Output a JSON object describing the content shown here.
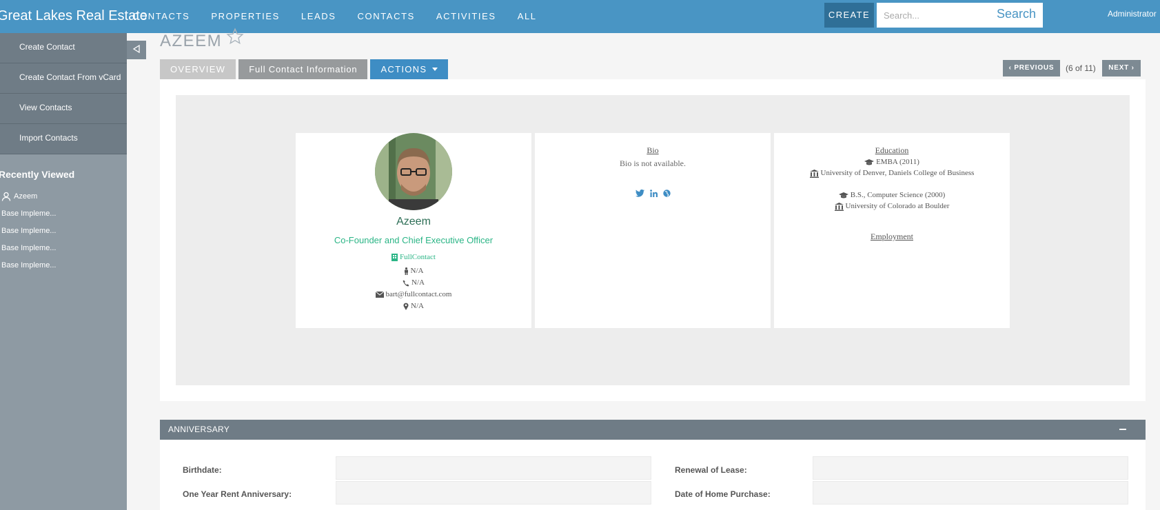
{
  "brand": "Great Lakes Real Estate",
  "nav": [
    "CONTACTS",
    "PROPERTIES",
    "LEADS",
    "CONTACTS",
    "ACTIVITIES",
    "ALL"
  ],
  "header": {
    "create_label": "CREATE",
    "search_placeholder": "Search...",
    "search_label": "Search",
    "user": "Administrator"
  },
  "sidebar": {
    "actions": [
      "Create Contact",
      "Create Contact From vCard",
      "View Contacts",
      "Import Contacts"
    ],
    "recent_title": "Recently Viewed",
    "recent": [
      "Azeem",
      "Base Impleme...",
      "Base Impleme...",
      "Base Impleme...",
      "Base Impleme..."
    ]
  },
  "record": {
    "title": "AZEEM",
    "tabs": [
      "OVERVIEW",
      "Full Contact Information",
      "ACTIONS"
    ],
    "pager": {
      "previous": "PREVIOUS",
      "count": "(6 of 11)",
      "next": "NEXT"
    }
  },
  "profile": {
    "name": "Azeem",
    "job_title": "Co-Founder and Chief Executive Officer",
    "company": "FullContact",
    "gender": "N/A",
    "phone": "N/A",
    "email": "bart@fullcontact.com",
    "location": "N/A"
  },
  "bio": {
    "heading": "Bio",
    "text": "Bio is not available."
  },
  "education": {
    "heading": "Education",
    "entries": [
      {
        "degree": "EMBA (2011)",
        "school": "University of Denver, Daniels College of Business"
      },
      {
        "degree": "B.S., Computer Science (2000)",
        "school": "University of Colorado at Boulder"
      }
    ],
    "employment_heading": "Employment"
  },
  "anniversary": {
    "title": "ANNIVERSARY",
    "fields": [
      "Birthdate:",
      "Renewal of Lease:",
      "One Year Rent Anniversary:",
      "Date of Home Purchase:"
    ]
  },
  "colors": {
    "topbar": "#4995c4",
    "sidebar": "#8e9aa3",
    "accent_green": "#2bb586",
    "actions_blue": "#3e8dc4"
  }
}
